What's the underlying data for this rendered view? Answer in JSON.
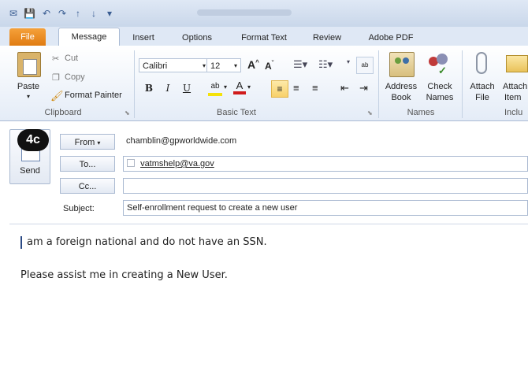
{
  "tabs": {
    "file": "File",
    "message": "Message",
    "insert": "Insert",
    "options": "Options",
    "format_text": "Format Text",
    "review": "Review",
    "adobe_pdf": "Adobe PDF"
  },
  "clipboard": {
    "paste": "Paste",
    "cut": "Cut",
    "copy": "Copy",
    "format_painter": "Format Painter",
    "group_label": "Clipboard"
  },
  "basic_text": {
    "font": "Calibri",
    "size": "12",
    "bold": "B",
    "italic": "I",
    "underline": "U",
    "group_label": "Basic Text"
  },
  "names": {
    "address_book_line1": "Address",
    "address_book_line2": "Book",
    "check_names_line1": "Check",
    "check_names_line2": "Names",
    "group_label": "Names"
  },
  "include": {
    "attach_file_line1": "Attach",
    "attach_file_line2": "File",
    "attach_item_line1": "Attach",
    "attach_item_line2": "Item",
    "group_label": "Inclu"
  },
  "annotation": "4c",
  "compose": {
    "send": "Send",
    "from_button": "From",
    "from_value": "chamblin@gpworldwide.com",
    "to_button": "To...",
    "to_value": "vatmshelp@va.gov",
    "cc_button": "Cc...",
    "cc_value": "",
    "subject_label": "Subject:",
    "subject_value": "Self-enrollment request to create a new user"
  },
  "body": {
    "line1": "am a foreign national and do not have an SSN.",
    "line2": "Please assist me in creating a New User."
  },
  "colors": {
    "file_tab": "#e07b12",
    "ribbon_bg": "#e4ecf7",
    "annotation_bg": "#111111"
  }
}
